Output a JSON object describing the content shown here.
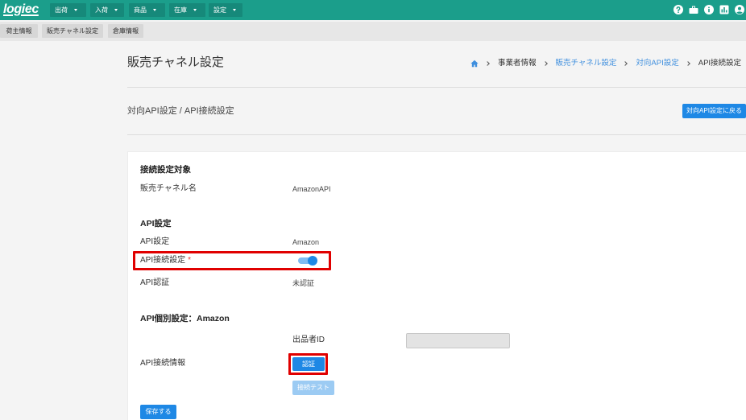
{
  "colors": {
    "header": "#1b9e8b",
    "nav_item": "#16897a",
    "primary": "#1e88e5",
    "primary_disabled": "#9ccbf3",
    "link": "#3f8fde",
    "required": "#e53935",
    "highlight": "#e00000"
  },
  "header": {
    "logo": "logiec",
    "nav": [
      {
        "label": "出荷"
      },
      {
        "label": "入荷"
      },
      {
        "label": "商品"
      },
      {
        "label": "在庫"
      },
      {
        "label": "設定"
      }
    ],
    "icons": [
      "question-circle-icon",
      "briefcase-icon",
      "info-circle-icon",
      "chart-icon",
      "user-icon"
    ]
  },
  "subnav": {
    "tabs": [
      {
        "label": "荷主情報"
      },
      {
        "label": "販売チャネル設定"
      },
      {
        "label": "倉庫情報"
      }
    ]
  },
  "page": {
    "title": "販売チャネル設定",
    "breadcrumb": {
      "home_icon": "home-icon",
      "items": [
        {
          "label": "事業者情報"
        },
        {
          "label": "販売チャネル設定"
        },
        {
          "label": "対向API設定"
        },
        {
          "label": "API接続設定"
        }
      ]
    },
    "subtitle": "対向API設定 / API接続設定",
    "back_button": "対向API設定に戻る"
  },
  "form": {
    "target_section": {
      "heading": "接続設定対象",
      "channel_name_label": "販売チャネル名",
      "channel_name_value": "AmazonAPI"
    },
    "api_section": {
      "heading": "API設定",
      "api_setting_label": "API設定",
      "api_setting_value": "Amazon",
      "connection_label": "API接続設定",
      "required_mark": "*",
      "connection_enabled": true,
      "auth_label": "API認証",
      "auth_value": "未認証"
    },
    "individual_section": {
      "heading": "API個別設定：Amazon",
      "seller_id_label": "出品者ID",
      "seller_id_value": "",
      "connection_info_label": "API接続情報",
      "auth_button": "認証",
      "test_button": "接続テスト",
      "test_button_disabled": true
    },
    "save_button": "保存する"
  }
}
